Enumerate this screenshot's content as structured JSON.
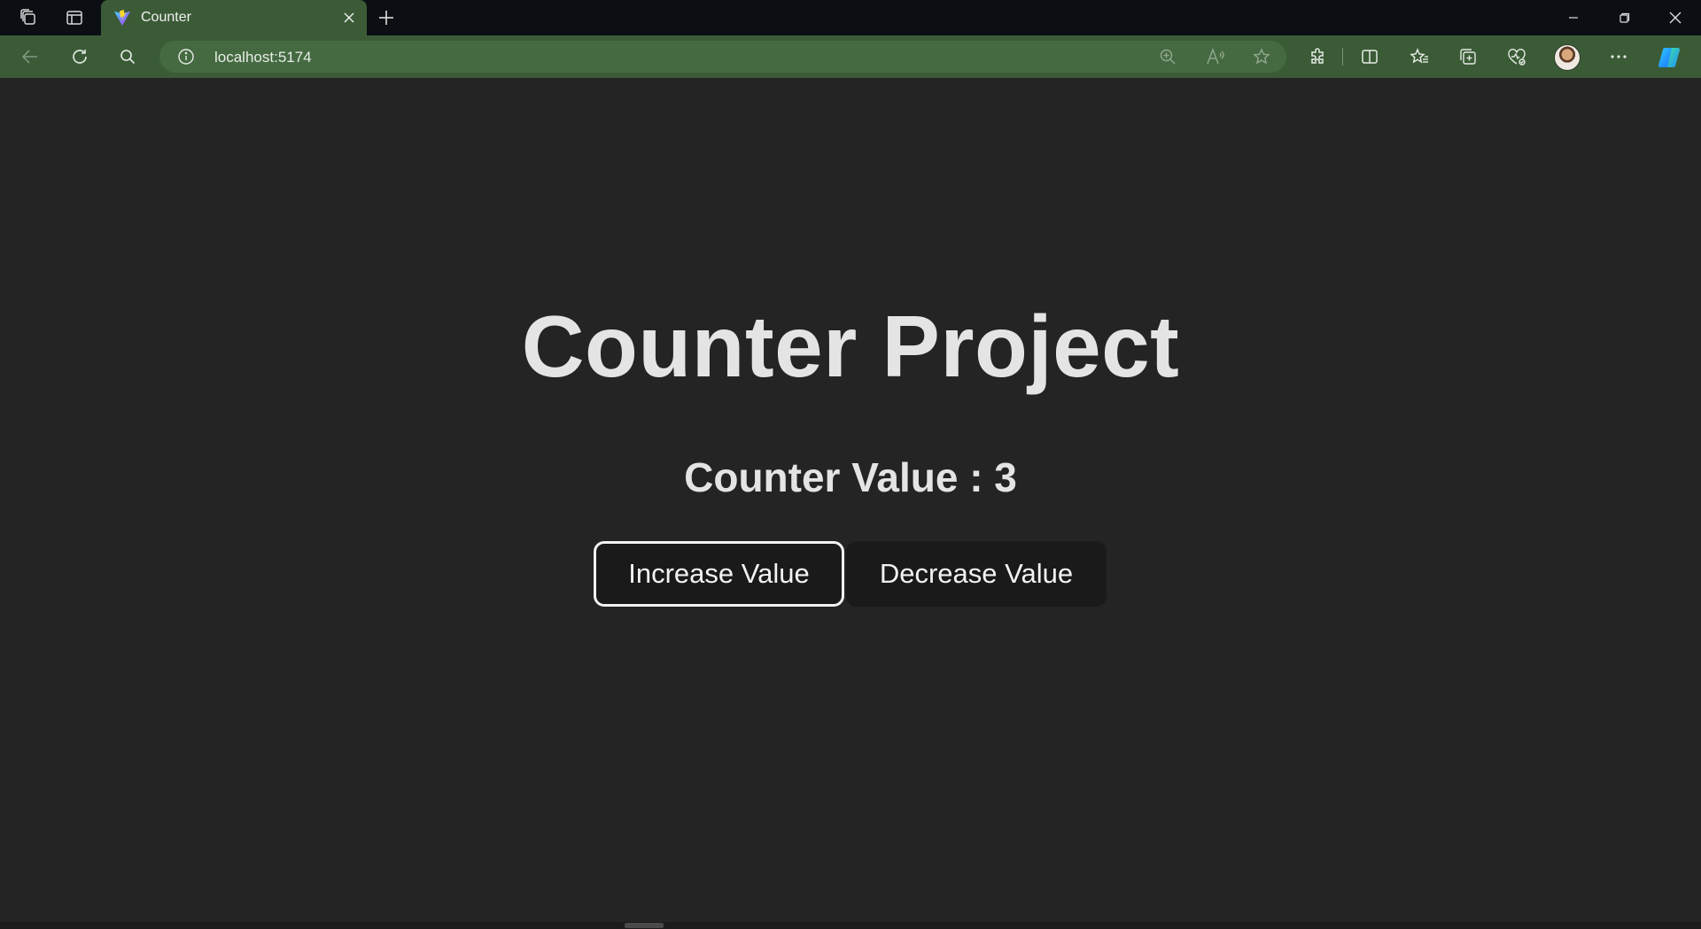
{
  "browser": {
    "tab": {
      "title": "Counter",
      "favicon": "vite-logo-icon"
    },
    "address": {
      "url": "localhost:5174"
    },
    "colors": {
      "frame": "#3b5b37",
      "titlebar": "#0b0f14",
      "address_bg": "#456a41"
    },
    "toolbar_icons": [
      "back-arrow-icon",
      "refresh-icon",
      "search-icon",
      "site-info-icon",
      "zoom-icon",
      "read-aloud-icon",
      "favorite-star-icon",
      "extensions-icon",
      "split-screen-icon",
      "favorites-icon",
      "collections-icon",
      "browser-essentials-icon",
      "profile-avatar",
      "more-menu-icon",
      "copilot-icon"
    ],
    "window_controls": [
      "minimize-icon",
      "restore-icon",
      "close-icon"
    ]
  },
  "page": {
    "background": "#242424",
    "title": "Counter Project",
    "counter_text": "Counter Value : 3",
    "buttons": {
      "increase": "Increase Value",
      "decrease": "Decrease Value"
    }
  }
}
